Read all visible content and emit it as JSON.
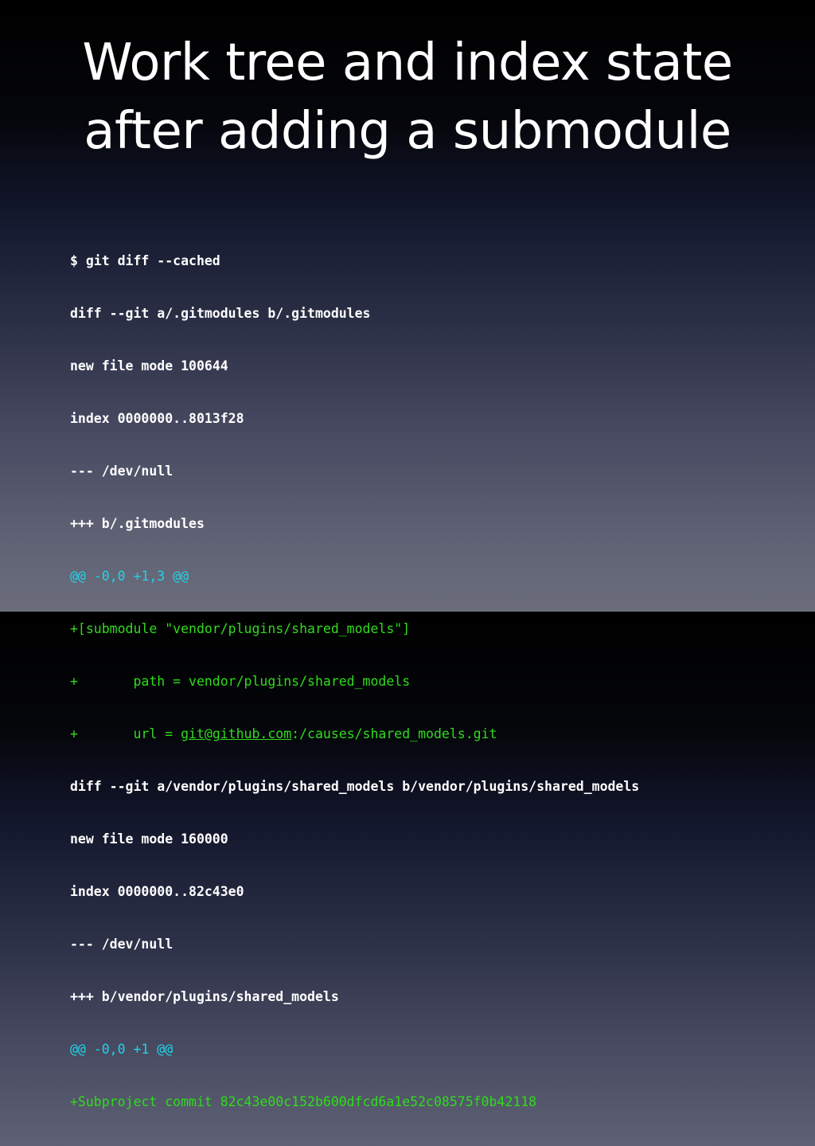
{
  "slide": {
    "title_line_1": "Work tree and index state",
    "title_line_2": "after adding a submodule"
  },
  "terminal": {
    "lines": [
      {
        "kind": "plain",
        "text": "$ git diff --cached"
      },
      {
        "kind": "plain",
        "text": "diff --git a/.gitmodules b/.gitmodules"
      },
      {
        "kind": "plain",
        "text": "new file mode 100644"
      },
      {
        "kind": "plain",
        "text": "index 0000000..8013f28"
      },
      {
        "kind": "plain",
        "text": "--- /dev/null"
      },
      {
        "kind": "plain",
        "text": "+++ b/.gitmodules"
      },
      {
        "kind": "hunk",
        "text": "@@ -0,0 +1,3 @@"
      },
      {
        "kind": "added",
        "text": "+[submodule \"vendor/plugins/shared_models\"]"
      },
      {
        "kind": "added",
        "text": "+       path = vendor/plugins/shared_models"
      },
      {
        "kind": "added",
        "prefix": "+       url = ",
        "link": "git@github.com",
        "suffix": ":/causes/shared_models.git"
      },
      {
        "kind": "plain",
        "text": "diff --git a/vendor/plugins/shared_models b/vendor/plugins/shared_models"
      },
      {
        "kind": "plain",
        "text": "new file mode 160000"
      },
      {
        "kind": "plain",
        "text": "index 0000000..82c43e0"
      },
      {
        "kind": "plain",
        "text": "--- /dev/null"
      },
      {
        "kind": "plain",
        "text": "+++ b/vendor/plugins/shared_models"
      },
      {
        "kind": "hunk",
        "text": "@@ -0,0 +1 @@"
      },
      {
        "kind": "added",
        "text": "+Subproject commit 82c43e00c152b600dfcd6a1e52c08575f0b42118"
      }
    ]
  },
  "colors": {
    "plain": "#ffffff",
    "hunk": "#1fd3e8",
    "added": "#2fdc1b"
  }
}
